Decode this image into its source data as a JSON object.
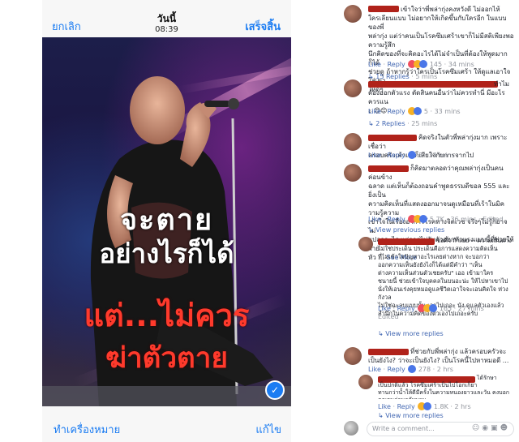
{
  "editor": {
    "cancel_label": "ยกเลิก",
    "date_label": "วันนี้",
    "time_label": "08:39",
    "done_label": "เสร็จสิ้น",
    "tools_label": "ทำเครื่องหมาย",
    "edit_label": "แก้ไข",
    "photo_text": {
      "line1": "จะตาย",
      "line2": "อย่างไรก็ได้",
      "line3": "แต่...ไม่ควร",
      "line4": "ฆ่าตัวตาย"
    },
    "colors": {
      "accent": "#1b7cf2",
      "red_text": "#ff3a2c"
    }
  },
  "comments": [
    {
      "text": "เข้าใจว่าพี่พล่ากุ่งคงหวังดี ไม่ออกไห้\nใครเลียนแบบ ไม่อยากให้เกิดขึ้นกับใครอีก ในแบบของพี่\nพล่ากุ่ง แต่ว่าคนเป็นโรคซึมเศร้าเขาก็ไม่มีสติเพียงพอความรู้สึก\nนึกคิดของที่จะคิดอะไรได้ไม่จำเป็นที่ต้องให้พูดมากก็ได้\nช่วยดู ถ้าหากรู้ว่าใครเป็นโรคซึมเศร้า ให้ดูแลเอาใจใส่เขา\nให้ดีๆ",
      "like": "Like",
      "reply": "Reply",
      "count": "145",
      "time": "34 mins",
      "replies": "15 Replies",
      "replies_time": "5 mins"
    },
    {
      "text": "ทำไม\nต้องออกตัวแรง ตัดสินคนอื่นว่าไม่ควรทำนี่ มีอะไรควรแน\nะ 😊😊",
      "like": "Like",
      "reply": "Reply",
      "count": "5",
      "time": "33 mins",
      "replies": "2 Replies",
      "replies_time": "25 mins"
    },
    {
      "text": "คิดจริงในตัวพี่พล่ากุ่งมาก เพราะเชื่อว่า\nครอบครัวเค้าเองก็เสียใจกับการจากไป",
      "like": "Like",
      "reply": "Reply",
      "count": "3",
      "time": "33 mins"
    },
    {
      "text": "ก็คิดมาตลอดว่าคุณพล่ากุ่งเป็นคนค่อนข้าง\nฉลาด แต่เห็นก็ต้องถอนคำพูดธรรมดีขอล 555 และยิ่งเป็น\nความคิดเห็นที่แสดงออกมาจนดูเหมือนที่เร้าในมิความรู้ความ\nเข้าใจในเรื่องอาการโรคทางจิตเวช จริงๆไม่รู้ก็อาจไม่\nแปลกอะไร แต่การไม่รับตัวออกตัวแรงแบบนี้ที่ช่วยให้ฝ่าย\nหัว ...",
      "see_more": "See More",
      "like": "Like",
      "reply": "Reply",
      "count": "5.7K",
      "time": "36 mins",
      "edited": "Edited",
      "view_previous": "View previous replies"
    },
    {
      "text": "ขอศึ้ว ก้าเบย -- ความเห็นต่าง\nไม่ใช่ประเด็น ประเด็นคือการแสดงความคิดเห็น\nที่ไม่เข้าใจปัญหาอะไรเลยต่างหาก จะบอกว่า\nออกความเห็นยังยังไงก็ได้แต่มีคำว่า \"เห็น\nต่างความเห็นส่วนตัวเชยครับ\" เออ เข้ามาใคร\nชนายนี้ ช่วยเข้าใจบุคคลในบนอะน่ะ ให้ไปหาเขาไป\nนั่งให้เอนเร่งคุยหมอดูแลชีวิตเอาใจจะเอนคิดใจ ห่วงกังวล\nไม่ใช่ฉะลบแบบนั้น เอาไปเถอะ นัง ดูแลตัวเองแล้ว\nสำนึกในความคิดของตัวเองไปเถอะครับ",
      "edited": "Edited",
      "like": "Like",
      "reply": "Reply",
      "count": "165",
      "time": "27 mins",
      "view_more": "View more replies"
    },
    {
      "text": "ที่ช่วยกับพี่พล่ากุ่ง แล้วครอบครัวจะ\nเป็นยังไง? ว่าจะเป็นยังไง? เป็นโรคนี้ไปหาหมอดี ...",
      "like": "Like",
      "reply": "Reply",
      "count": "278",
      "time": "2 hrs"
    },
    {
      "text": "ได้รักษา\nเป็นปกติแล้ว โรคซึมเศร้าเป็นไปโอกเก็ยา\nทานกว่าน้ำให้ดีมีครั้งในความหนองยาวและวัน คงบอกคุณจนก่อนกลับบาน\nพาทา 2เนื้อเลยชอบ ส่งต่อการเชยได้เลยนะ บอกเรื่องเชยดีนะ\nใจ\nใดๆมา ชิ้นพระศึกชาญไม่เกรงกัน สลังเอนเรียน",
      "like": "Like",
      "reply": "Reply",
      "count": "1.8K",
      "time": "2 hrs",
      "view_more": "View more replies"
    }
  ],
  "write_comment_placeholder": "Write a comment..."
}
